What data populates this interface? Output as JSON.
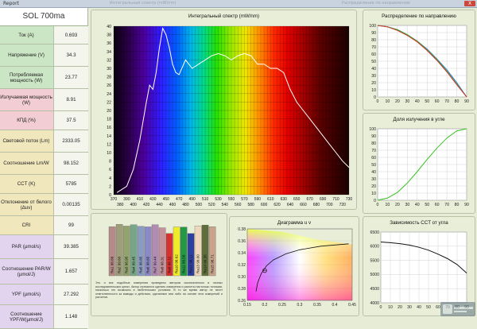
{
  "window": {
    "title": "Report",
    "ghost_left": "Интегральный спектр (mW/nm)",
    "ghost_right": "Распределение по направлению",
    "close_label": "X"
  },
  "left": {
    "title": "SOL 700ma",
    "rows": [
      {
        "label": "Ток (A)",
        "value": "0.693",
        "color": "#cbe6c4"
      },
      {
        "label": "Напряжение (V)",
        "value": "34.3",
        "color": "#cbe6c4"
      },
      {
        "label": "Потребляемая мощность (W)",
        "value": "23.77",
        "color": "#cbe6c4"
      },
      {
        "label": "Излучаемая мощность (W)",
        "value": "8.91",
        "color": "#f2cdd3"
      },
      {
        "label": "КПД (%)",
        "value": "37.5",
        "color": "#f2cdd3"
      },
      {
        "label": "Световой поток (Lm)",
        "value": "2333.05",
        "color": "#f1e7bd"
      },
      {
        "label": "Соотношение Lm/W",
        "value": "98.152",
        "color": "#f1e7bd"
      },
      {
        "label": "CCT (K)",
        "value": "5785",
        "color": "#f1e7bd"
      },
      {
        "label": "Отклонение от белого (Δuv)",
        "value": "0.00135",
        "color": "#f1e7bd"
      },
      {
        "label": "CRI",
        "value": "99",
        "color": "#f1e7bd"
      },
      {
        "label": "PAR (µmol/s)",
        "value": "39.385",
        "color": "#e2d4ef"
      },
      {
        "label": "Соотношение PAR/W (µmol/J)",
        "value": "1.657",
        "color": "#e2d4ef"
      },
      {
        "label": "YPF (µmol/s)",
        "value": "27.292",
        "color": "#e2d4ef"
      },
      {
        "label": "Соотношение YPF/W(µmol/J)",
        "value": "1.148",
        "color": "#e2d4ef"
      }
    ]
  },
  "spectrum": {
    "title": "Интегральный спектр (mW/nm)",
    "y_ticks": [
      "0",
      "2",
      "4",
      "6",
      "8",
      "10",
      "12",
      "14",
      "16",
      "18",
      "20",
      "22",
      "24",
      "26",
      "28",
      "30",
      "32",
      "34",
      "36",
      "38",
      "40"
    ],
    "x_ticks_top": [
      "370",
      "390",
      "410",
      "430",
      "450",
      "470",
      "490",
      "510",
      "530",
      "550",
      "570",
      "590",
      "610",
      "630",
      "650",
      "670",
      "690",
      "710",
      "730"
    ],
    "x_ticks_bottom": [
      "380",
      "400",
      "420",
      "440",
      "460",
      "480",
      "500",
      "520",
      "540",
      "560",
      "580",
      "600",
      "620",
      "640",
      "660",
      "680",
      "700",
      "720"
    ]
  },
  "chart_data": [
    {
      "type": "line",
      "title": "Интегральный спектр (mW/nm)",
      "x": [
        375,
        390,
        400,
        410,
        420,
        425,
        430,
        435,
        440,
        445,
        450,
        455,
        460,
        465,
        470,
        480,
        490,
        500,
        510,
        520,
        530,
        540,
        550,
        560,
        570,
        580,
        590,
        600,
        610,
        620,
        630,
        640,
        650,
        660,
        670,
        680,
        690,
        700,
        710,
        720,
        730
      ],
      "y": [
        0.5,
        2,
        6,
        13,
        22,
        26,
        25,
        29,
        35,
        39.5,
        38,
        35,
        31,
        29,
        28.5,
        32,
        30,
        31,
        32,
        33,
        33.5,
        33,
        32,
        33,
        33.5,
        33,
        31,
        31,
        30,
        30,
        29,
        25,
        22,
        20,
        18,
        16,
        14,
        12,
        10,
        8,
        6.5
      ],
      "xlim": [
        370,
        730
      ],
      "ylim": [
        0,
        40
      ]
    },
    {
      "type": "line",
      "title": "Распределение по направлению",
      "x": [
        0,
        10,
        20,
        30,
        40,
        50,
        60,
        70,
        80,
        90
      ],
      "series": [
        {
          "values": [
            100,
            98,
            94,
            87,
            78,
            67,
            53,
            38,
            20,
            0
          ],
          "color": "#2a7bd4"
        },
        {
          "values": [
            100,
            98,
            94,
            87,
            78,
            66,
            52,
            36,
            18,
            0
          ],
          "color": "#2aa02a"
        },
        {
          "values": [
            100,
            98,
            93,
            86,
            77,
            65,
            51,
            35,
            17,
            0
          ],
          "color": "#d43c2a"
        }
      ],
      "xlim": [
        0,
        90
      ],
      "ylim": [
        0,
        100
      ]
    },
    {
      "type": "line",
      "title": "Доля излучения в угле",
      "x": [
        0,
        10,
        20,
        30,
        40,
        50,
        60,
        70,
        80,
        90
      ],
      "series": [
        {
          "values": [
            0,
            3,
            11,
            24,
            40,
            57,
            73,
            87,
            97,
            100
          ],
          "color": "#35c21f"
        }
      ],
      "xlim": [
        0,
        90
      ],
      "ylim": [
        0,
        100
      ]
    },
    {
      "type": "line",
      "title": "Зависимость CCT от угла",
      "x": [
        0,
        10,
        20,
        30,
        40,
        50,
        60,
        70,
        80,
        90
      ],
      "series": [
        {
          "values": [
            6150,
            6125,
            6090,
            6040,
            5960,
            5860,
            5720,
            5560,
            5350,
            5050
          ],
          "color": "#111111"
        }
      ],
      "xlim": [
        0,
        90
      ],
      "ylim": [
        4000,
        6500
      ]
    },
    {
      "type": "bar",
      "title": "CRI",
      "categories": [
        "Ra1",
        "Ra2",
        "Ra3",
        "Ra4",
        "Ra5",
        "Ra6",
        "Ra7",
        "Ra8",
        "Ra9",
        "Ra10",
        "Ra11",
        "Ra12",
        "Ra13",
        "Ra14",
        "Ra15"
      ],
      "values": [
        98.68,
        99.6,
        98.95,
        99.45,
        98.85,
        98.65,
        99.44,
        98.31,
        96.12,
        98.62,
        98.58,
        96.11,
        99.0,
        99.35,
        98.71
      ],
      "colors": [
        "#b58a88",
        "#9f9e7a",
        "#93a36d",
        "#77a689",
        "#8a9cc3",
        "#8c8ac4",
        "#b28bb5",
        "#c4929c",
        "#d93030",
        "#f0ec2c",
        "#239945",
        "#2f3fa0",
        "#eed7bd",
        "#5d6e3a",
        "#c8a48a"
      ]
    },
    {
      "type": "scatter",
      "title": "Диаграмма u v",
      "x": [
        0.2
      ],
      "y": [
        0.31
      ],
      "xlim": [
        0.15,
        0.45
      ],
      "ylim": [
        0.26,
        0.38
      ]
    }
  ],
  "directional": {
    "title": "Распределение по направлению",
    "y_ticks": [
      "0",
      "10",
      "20",
      "30",
      "40",
      "50",
      "60",
      "70",
      "80",
      "90",
      "100"
    ],
    "x_ticks": [
      "0",
      "10",
      "20",
      "30",
      "40",
      "50",
      "60",
      "70",
      "80",
      "90"
    ]
  },
  "fraction": {
    "title": "Доля излучения в угле",
    "y_ticks": [
      "0",
      "10",
      "20",
      "30",
      "40",
      "50",
      "60",
      "70",
      "80",
      "90",
      "100"
    ],
    "x_ticks": [
      "0",
      "10",
      "20",
      "30",
      "40",
      "50",
      "60",
      "70",
      "80",
      "90"
    ]
  },
  "cct": {
    "title": "Зависимость CCT от угла",
    "y_ticks": [
      "4000",
      "4500",
      "5000",
      "5500",
      "6000",
      "6500"
    ],
    "x_ticks": [
      "0",
      "10",
      "20",
      "30",
      "40",
      "50",
      "60",
      "70",
      "80",
      "90"
    ]
  },
  "uv": {
    "title": "Диаграмма u v",
    "y_ticks": [
      "0.26",
      "0.28",
      "0.30",
      "0.32",
      "0.34",
      "0.36",
      "0.38"
    ],
    "x_ticks": [
      "0.15",
      "0.2",
      "0.25",
      "0.3",
      "0.35",
      "0.4",
      "0.45"
    ]
  },
  "cri": {
    "labels": [
      "Ra1 98.68",
      "Ra2 99.60",
      "Ra3 98.95",
      "Ra4 99.45",
      "Ra5 98.85",
      "Ra6 98.65",
      "Ra7 99.44",
      "Ra8 98.31",
      "Ra9 96.12",
      "Ra10 98.62",
      "Ra11 98.58",
      "Ra12 96.11",
      "Ra13 99.00",
      "Ra14 99.35",
      "Ra15 98.71"
    ],
    "note": "Это и все подобные измерения проведены автором исключительно в личных исследовательских целях. Автор стремился сделать измерения и расчеты настолько точными, насколько это возможно в любительских условиях. В то же время автор не несет ответственности за выводы и действия, сделанные кем либо на основе этих измерений и расчетов."
  },
  "watermark": "overclockers"
}
